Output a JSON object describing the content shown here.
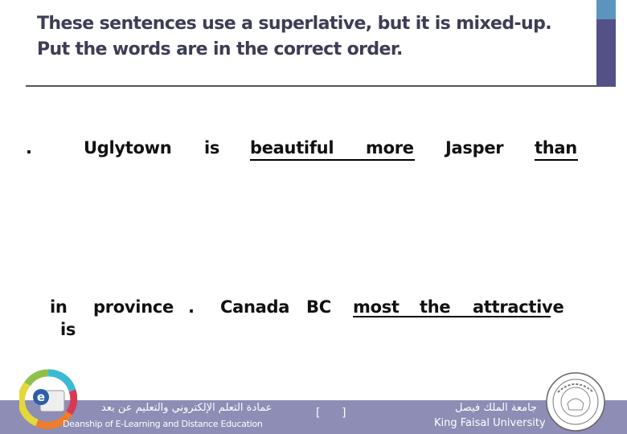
{
  "slide": {
    "title_lines": [
      "These sentences use a superlative, but it is mixed-up.",
      "Put the words are in the correct order."
    ],
    "accent_colors": {
      "top": "#5b95bf",
      "bar": "#545088"
    }
  },
  "exercise": {
    "row1": {
      "words": [
        ".",
        "Uglytown",
        "is",
        "beautiful",
        "more",
        "Jasper",
        "than"
      ],
      "underlined": [
        "beautiful",
        "more",
        "than"
      ]
    },
    "row2": {
      "words": [
        "in",
        "province",
        ".",
        "Canada",
        "BC",
        "most",
        "the",
        "attractive",
        "is"
      ],
      "underlined": [
        "most",
        "the",
        "attractive"
      ]
    }
  },
  "footer": {
    "deanship_ar": "عمادة التعلم الإلكتروني والتعليم عن بعد",
    "deanship_en": "Deanship of E-Learning and Distance Education",
    "page_open": "[",
    "page_close": "]",
    "university_ar": "جامعة الملك فيصل",
    "university_en": "King Faisal University",
    "band_color": "#8d8db6"
  }
}
